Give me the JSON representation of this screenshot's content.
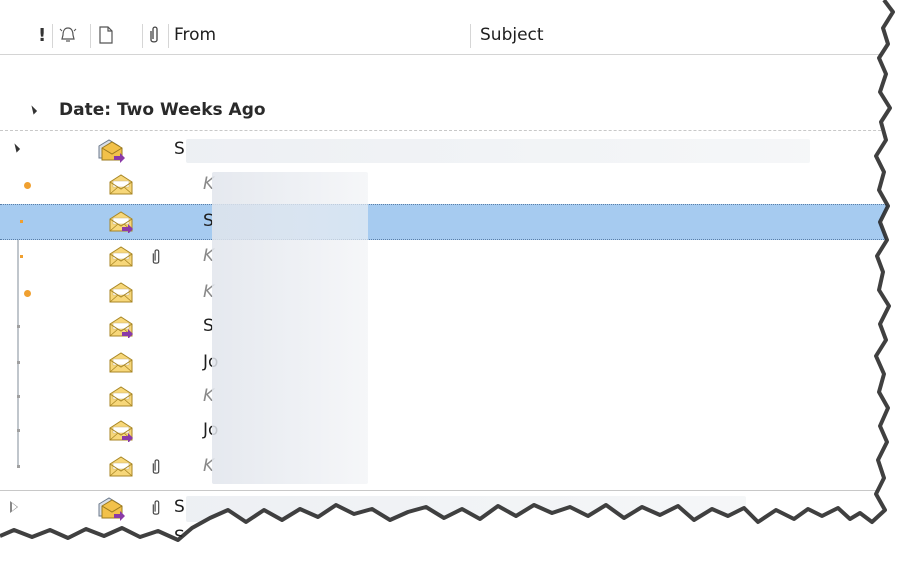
{
  "columns": {
    "importance_glyph": "!",
    "from": "From",
    "subject": "Subject"
  },
  "group": {
    "label": "Date: Two Weeks Ago"
  },
  "thread": {
    "sender_initial": "S"
  },
  "messages": [
    {
      "from": "K",
      "unread": false,
      "replied": false,
      "attachment": false,
      "marker": "orange-dot"
    },
    {
      "from": "S",
      "unread": true,
      "replied": true,
      "attachment": false,
      "marker": "orange-square",
      "selected": true
    },
    {
      "from": "K",
      "unread": false,
      "replied": false,
      "attachment": true,
      "marker": "orange-square"
    },
    {
      "from": "K",
      "unread": false,
      "replied": false,
      "attachment": false,
      "marker": "orange-dot"
    },
    {
      "from": "S",
      "unread": true,
      "replied": true,
      "attachment": false,
      "marker": "gray-square"
    },
    {
      "from": "Jo",
      "unread": true,
      "replied": false,
      "attachment": false,
      "marker": "gray-square"
    },
    {
      "from": "K",
      "unread": false,
      "replied": false,
      "attachment": false,
      "marker": "gray-square"
    },
    {
      "from": "Jo",
      "unread": true,
      "replied": true,
      "attachment": false,
      "marker": "gray-square"
    },
    {
      "from": "K",
      "unread": false,
      "replied": false,
      "attachment": true,
      "marker": "gray-square"
    }
  ],
  "next_thread": {
    "sender_initial": "S",
    "attachment": true
  },
  "icons": {
    "importance": "exclamation-icon",
    "reminder": "bell-icon",
    "item_type": "page-icon",
    "attachment": "paperclip-icon",
    "mail_read": "envelope-open-icon",
    "mail_replied": "envelope-replied-icon",
    "thread": "conversation-icon"
  },
  "colors": {
    "selection": "#a6cbf0",
    "category_marker": "#f0a030",
    "replied_arrow": "#8a3aa8",
    "envelope": "#f2c14a"
  }
}
